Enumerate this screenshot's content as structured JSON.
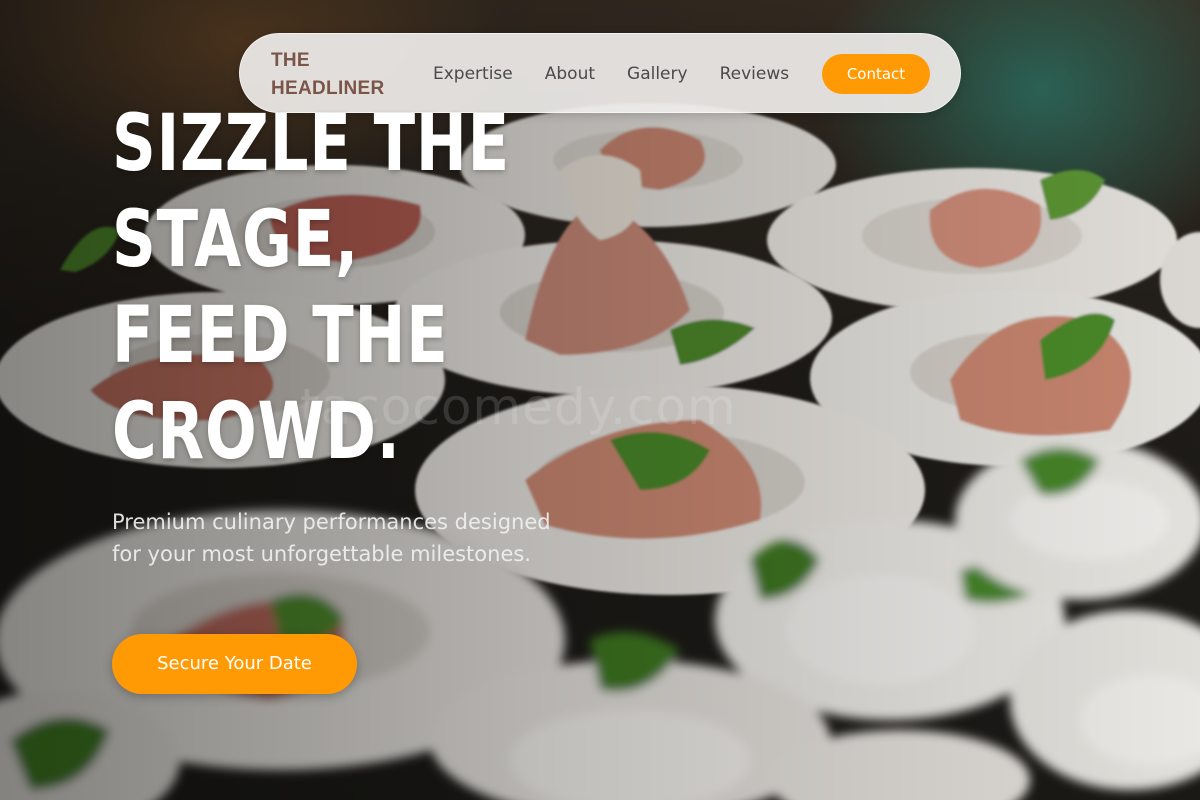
{
  "nav": {
    "brand_line1": "THE",
    "brand_line2": "HEADLINER",
    "links": [
      "Expertise",
      "About",
      "Gallery",
      "Reviews"
    ],
    "contact_label": "Contact"
  },
  "hero": {
    "title_lines": [
      "SIZZLE THE",
      "STAGE,",
      "FEED THE",
      "CROWD."
    ],
    "subtitle": "Premium culinary performances designed for your most unforgettable milestones.",
    "cta_label": "Secure Your Date",
    "background_image": "plated prosciutto and mozzarella appetizers with basil leaves on white dishes",
    "watermark": "tacocomedy.com"
  },
  "colors": {
    "accent": "#ff9a05",
    "brand_text": "#7a5548",
    "nav_background": "#eeece9",
    "hero_text": "#ffffff"
  }
}
